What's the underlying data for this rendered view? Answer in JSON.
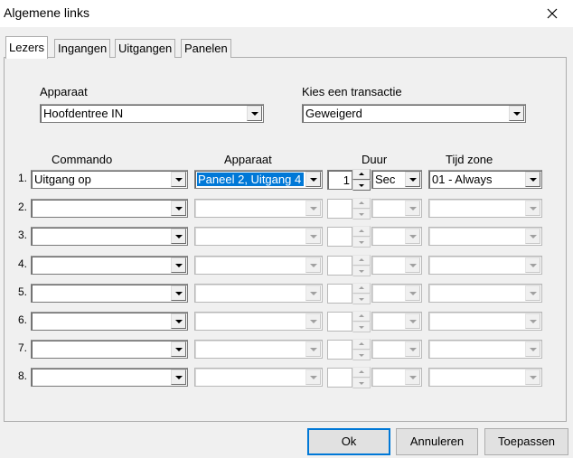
{
  "window": {
    "title": "Algemene links"
  },
  "tabs": [
    {
      "label": "Lezers",
      "active": true
    },
    {
      "label": "Ingangen",
      "active": false
    },
    {
      "label": "Uitgangen",
      "active": false
    },
    {
      "label": "Panelen",
      "active": false
    }
  ],
  "form": {
    "apparaat_label": "Apparaat",
    "apparaat_value": "Hoofdentree IN",
    "transactie_label": "Kies een transactie",
    "transactie_value": "Geweigerd"
  },
  "columns": {
    "commando": "Commando",
    "apparaat": "Apparaat",
    "duur": "Duur",
    "tijd_zone": "Tijd zone"
  },
  "rows": [
    {
      "num": "1.",
      "commando": "Uitgang op",
      "apparaat": "Paneel 2, Uitgang 4",
      "duur": "1",
      "unit": "Sec",
      "tijdzone": "01 - Always"
    },
    {
      "num": "2.",
      "commando": "",
      "apparaat": "",
      "duur": "",
      "unit": "",
      "tijdzone": ""
    },
    {
      "num": "3.",
      "commando": "",
      "apparaat": "",
      "duur": "",
      "unit": "",
      "tijdzone": ""
    },
    {
      "num": "4.",
      "commando": "",
      "apparaat": "",
      "duur": "",
      "unit": "",
      "tijdzone": ""
    },
    {
      "num": "5.",
      "commando": "",
      "apparaat": "",
      "duur": "",
      "unit": "",
      "tijdzone": ""
    },
    {
      "num": "6.",
      "commando": "",
      "apparaat": "",
      "duur": "",
      "unit": "",
      "tijdzone": ""
    },
    {
      "num": "7.",
      "commando": "",
      "apparaat": "",
      "duur": "",
      "unit": "",
      "tijdzone": ""
    },
    {
      "num": "8.",
      "commando": "",
      "apparaat": "",
      "duur": "",
      "unit": "",
      "tijdzone": ""
    }
  ],
  "buttons": {
    "ok": "Ok",
    "cancel": "Annuleren",
    "apply": "Toepassen"
  }
}
